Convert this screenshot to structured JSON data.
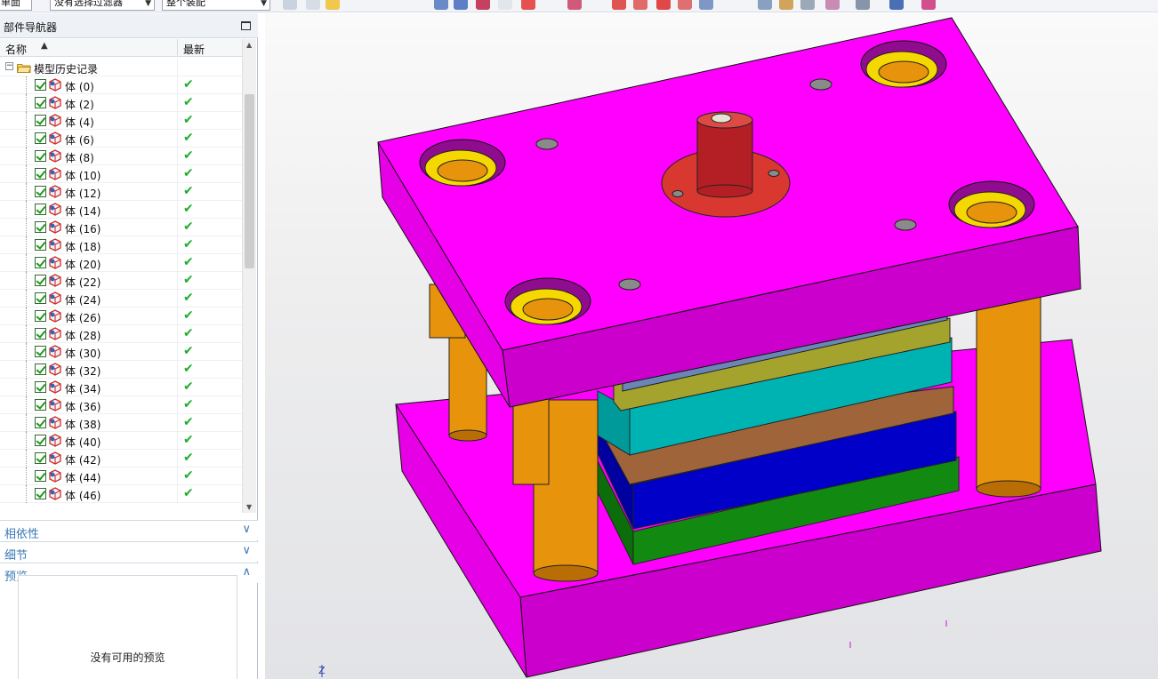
{
  "toolbar": {
    "filter_dropdown": "没有选择过滤器",
    "scope_dropdown": "整个装配",
    "left_fragment": "单面"
  },
  "navigator": {
    "title": "部件导航器",
    "columns": {
      "name": "名称",
      "latest": "最新"
    },
    "root": "模型历史记录",
    "bodies": [
      "体 (0)",
      "体 (2)",
      "体 (4)",
      "体 (6)",
      "体 (8)",
      "体 (10)",
      "体 (12)",
      "体 (14)",
      "体 (16)",
      "体 (18)",
      "体 (20)",
      "体 (22)",
      "体 (24)",
      "体 (26)",
      "体 (28)",
      "体 (30)",
      "体 (32)",
      "体 (34)",
      "体 (36)",
      "体 (38)",
      "体 (40)",
      "体 (42)",
      "体 (44)",
      "体 (46)"
    ]
  },
  "panels": {
    "dependencies": "相依性",
    "details": "细节",
    "preview": "预览",
    "preview_empty": "没有可用的预览"
  },
  "viewport": {
    "axis_label": "Z",
    "colors": {
      "plate": "#ff00ff",
      "pillar": "#e8930c",
      "bushing": "#f5d800",
      "sprue": "#d8382f",
      "cyan_plate": "#00b3b3",
      "olive_plate": "#a3a32e",
      "brown_plate": "#a0643a",
      "blue_plate": "#0000c8",
      "green_plate": "#128a12"
    }
  }
}
